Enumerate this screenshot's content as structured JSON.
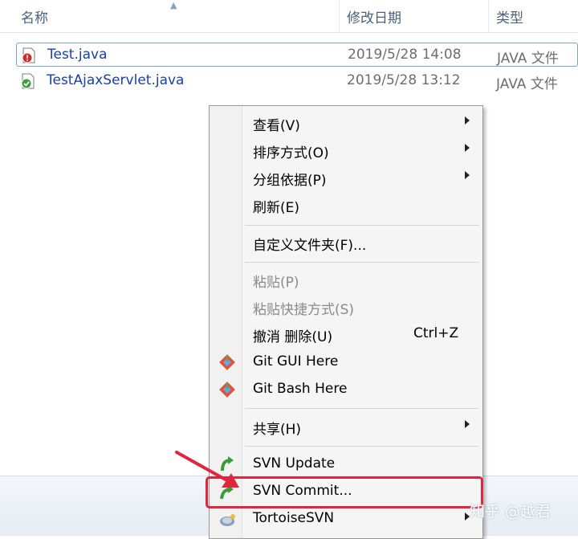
{
  "columns": {
    "name": "名称",
    "modified": "修改日期",
    "type": "类型"
  },
  "files": [
    {
      "name": "Test.java",
      "date": "2019/5/28 14:08",
      "type": "JAVA 文件",
      "status_icon": "svn-modified-icon",
      "status_color": "#d42b2b"
    },
    {
      "name": "TestAjaxServlet.java",
      "date": "2019/5/28 13:12",
      "type": "JAVA 文件",
      "status_icon": "svn-normal-icon",
      "status_color": "#3aa13a"
    }
  ],
  "menu": {
    "view": "查看(V)",
    "sort_by": "排序方式(O)",
    "group_by": "分组依据(P)",
    "refresh": "刷新(E)",
    "customize": "自定义文件夹(F)...",
    "paste": "粘贴(P)",
    "paste_shortcut": "粘贴快捷方式(S)",
    "undo_delete": "撤消 删除(U)",
    "undo_shortcut": "Ctrl+Z",
    "git_gui": "Git GUI Here",
    "git_bash": "Git Bash Here",
    "share": "共享(H)",
    "svn_update": "SVN Update",
    "svn_commit": "SVN Commit...",
    "tortoise": "TortoiseSVN"
  },
  "watermark": "知乎 @越君",
  "colors": {
    "highlight": "#e0263f",
    "link_text": "#1a3fa6",
    "svn_green": "#3b9a3b",
    "git_red": "#e0533b"
  }
}
